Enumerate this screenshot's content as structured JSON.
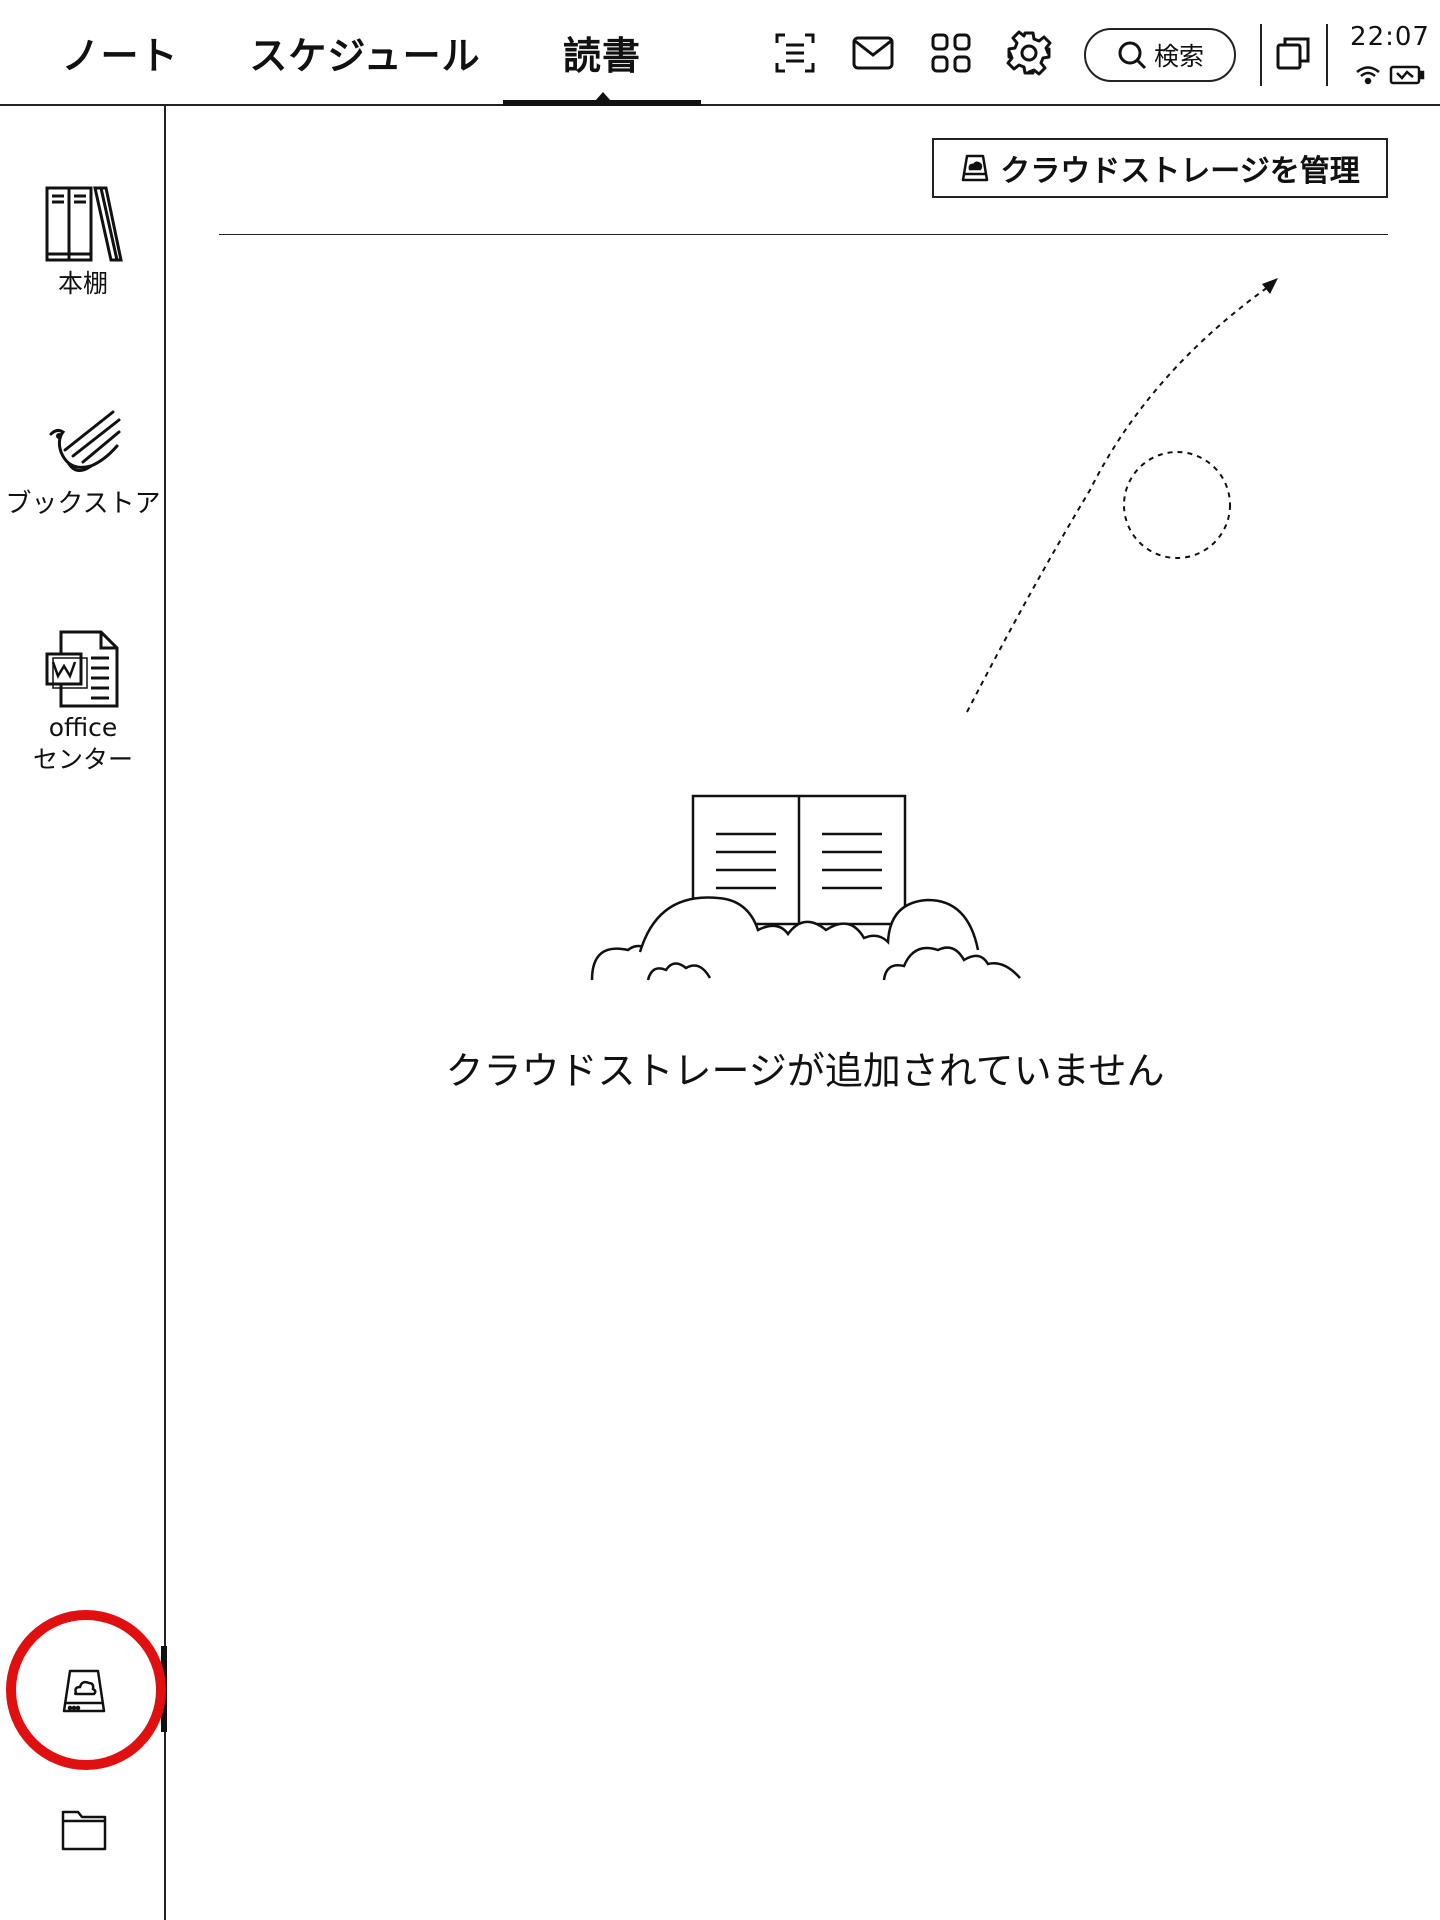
{
  "tabs": [
    {
      "label": "ノート"
    },
    {
      "label": "スケジュール"
    },
    {
      "label": "読書",
      "active": true
    }
  ],
  "toolbar": {
    "icons": [
      "scan-text-icon",
      "mail-icon",
      "apps-grid-icon",
      "settings-gear-icon"
    ],
    "search_label": "検索",
    "window_icon": "multiwindow-icon"
  },
  "status": {
    "time": "22:07",
    "icons": [
      "wifi-icon",
      "battery-charging-icon"
    ]
  },
  "sidebar": {
    "items": [
      {
        "label": "本棚",
        "icon": "bookshelf-icon"
      },
      {
        "label": "ブックストア",
        "icon": "bookstore-bird-icon"
      },
      {
        "label_line1": "office",
        "label_line2": "センター",
        "icon": "office-document-icon"
      }
    ],
    "bottom_icons": [
      "cloud-storage-icon",
      "folder-icon"
    ]
  },
  "main": {
    "manage_button_label": "クラウドストレージを管理",
    "manage_button_icon": "cloud-drive-icon",
    "empty_message": "クラウドストレージが追加されていません",
    "illustration_icon": "book-in-clouds-illustration"
  },
  "colors": {
    "foreground": "#111111",
    "background": "#ffffff",
    "highlight_ring": "#e01010"
  }
}
